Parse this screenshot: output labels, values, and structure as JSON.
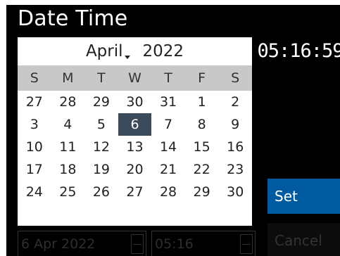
{
  "window": {
    "title": "Date Time"
  },
  "calendar": {
    "month": "April",
    "year": "2022",
    "weekdays": [
      "S",
      "M",
      "T",
      "W",
      "T",
      "F",
      "S"
    ],
    "days": [
      "27",
      "28",
      "29",
      "30",
      "31",
      "1",
      "2",
      "3",
      "4",
      "5",
      "6",
      "7",
      "8",
      "9",
      "10",
      "11",
      "12",
      "13",
      "14",
      "15",
      "16",
      "17",
      "18",
      "19",
      "20",
      "21",
      "22",
      "23",
      "24",
      "25",
      "26",
      "27",
      "28",
      "29",
      "30"
    ],
    "selected_day": "6"
  },
  "clock": {
    "time": "05:16:59"
  },
  "buttons": {
    "set": "Set",
    "cancel": "Cancel"
  },
  "fields": {
    "date_value": "6 Apr 2022",
    "time_value": "05:16"
  },
  "colors": {
    "selected_day_bg": "#3b4a5b",
    "set_button": "#005aa0",
    "weekday_header_bg": "#c8c8c8"
  },
  "icons": {
    "month_dropdown": "caret-down-icon",
    "spinner": "spinner-icon"
  }
}
